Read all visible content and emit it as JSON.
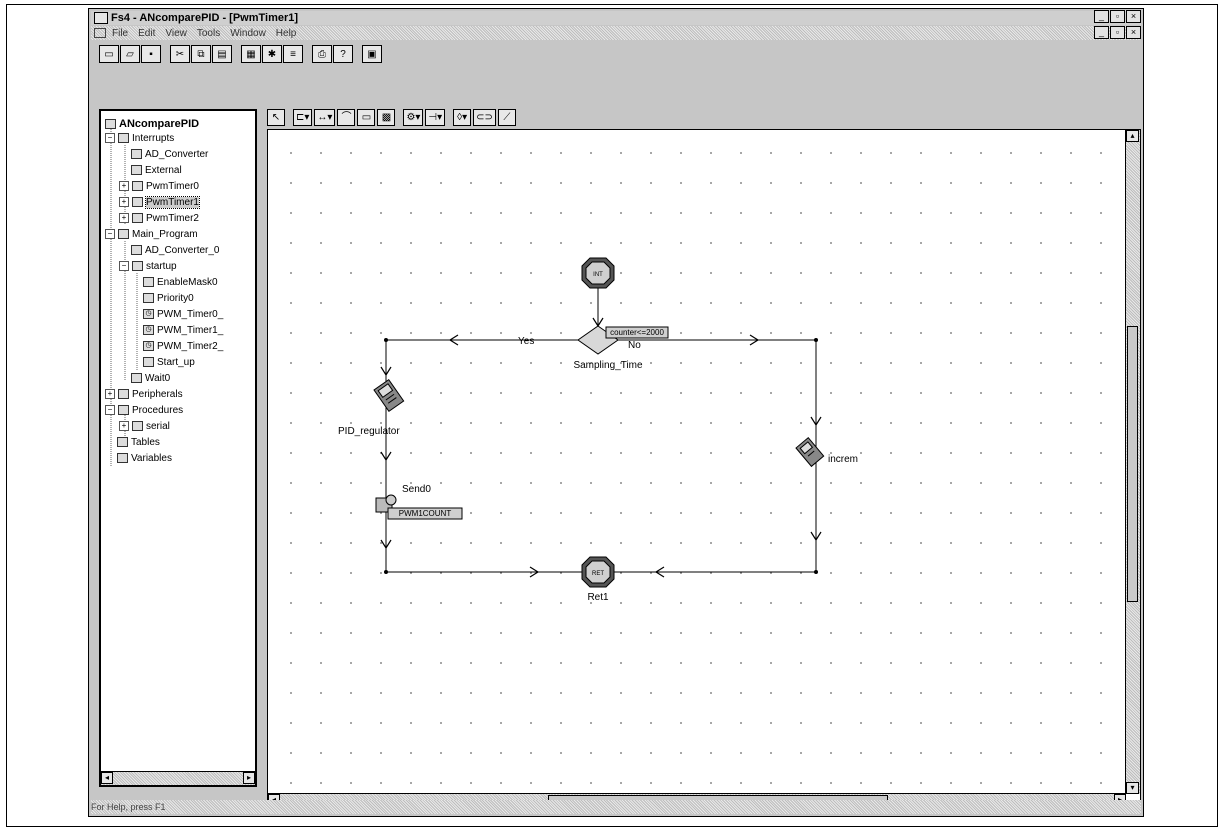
{
  "window": {
    "title": "Fs4 - ANcomparePID - [PwmTimer1]",
    "buttons": [
      "_",
      "▫",
      "×"
    ],
    "doc_buttons": [
      "_",
      "▫",
      "×"
    ]
  },
  "menu": [
    "File",
    "Edit",
    "View",
    "Tools",
    "Window",
    "Help"
  ],
  "tree": {
    "root": "ANcomparePID",
    "nodes": [
      {
        "label": "Interrupts"
      },
      {
        "label": "AD_Converter"
      },
      {
        "label": "External"
      },
      {
        "label": "PwmTimer0"
      },
      {
        "label": "PwmTimer1"
      },
      {
        "label": "PwmTimer2"
      },
      {
        "label": "Main_Program"
      },
      {
        "label": "AD_Converter_0"
      },
      {
        "label": "startup"
      },
      {
        "label": "EnableMask0"
      },
      {
        "label": "Priority0"
      },
      {
        "label": "PWM_Timer0_"
      },
      {
        "label": "PWM_Timer1_"
      },
      {
        "label": "PWM_Timer2_"
      },
      {
        "label": "Start_up"
      },
      {
        "label": "Wait0"
      },
      {
        "label": "Peripherals"
      },
      {
        "label": "Procedures"
      },
      {
        "label": "serial"
      },
      {
        "label": "Tables"
      },
      {
        "label": "Variables"
      }
    ]
  },
  "diagram": {
    "nodes": {
      "decision": {
        "label": "Sampling_Time",
        "tag": "counter<=2000",
        "yes": "Yes",
        "no": "No"
      },
      "pid": {
        "label": "PID_regulator"
      },
      "send": {
        "label": "Send0",
        "tag": "PWM1COUNT"
      },
      "increm": {
        "label": "increm"
      },
      "ret": {
        "label": "Ret1"
      }
    },
    "icon_glyphs": {
      "start": "INT",
      "ret": "RET"
    }
  },
  "status": "For Help, press F1"
}
